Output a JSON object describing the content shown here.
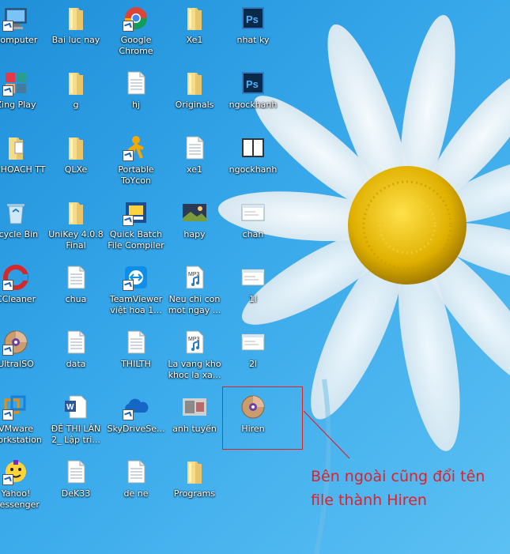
{
  "desktop": {
    "icons": [
      {
        "label": "Computer",
        "kind": "computer"
      },
      {
        "label": "Bai luc nay",
        "kind": "folder"
      },
      {
        "label": "Google Chrome",
        "kind": "chrome"
      },
      {
        "label": "Xe1",
        "kind": "folder"
      },
      {
        "label": "nhat ky",
        "kind": "photoshop"
      },
      {
        "label": "Zing Play",
        "kind": "zing"
      },
      {
        "label": "g",
        "kind": "folder"
      },
      {
        "label": "hj",
        "kind": "document"
      },
      {
        "label": "Originals",
        "kind": "folder"
      },
      {
        "label": "ngockhanh",
        "kind": "photoshop"
      },
      {
        "label": "UY HOACH TT",
        "kind": "folder-doc"
      },
      {
        "label": "QLXe",
        "kind": "folder"
      },
      {
        "label": "Portable ToYcon",
        "kind": "aim"
      },
      {
        "label": "xe1",
        "kind": "document"
      },
      {
        "label": "ngockhanh",
        "kind": "book"
      },
      {
        "label": "ecycle Bin",
        "kind": "recycle"
      },
      {
        "label": "UniKey 4.0.8 Final",
        "kind": "folder"
      },
      {
        "label": "Quick Batch File Compiler",
        "kind": "qbfc"
      },
      {
        "label": "hapy",
        "kind": "image"
      },
      {
        "label": "chan",
        "kind": "window"
      },
      {
        "label": "CCleaner",
        "kind": "ccleaner"
      },
      {
        "label": "chua",
        "kind": "document"
      },
      {
        "label": "TeamViewer việt hoa 1...",
        "kind": "teamviewer"
      },
      {
        "label": "Neu chi con mot ngay ...",
        "kind": "mp3"
      },
      {
        "label": "1l",
        "kind": "window"
      },
      {
        "label": "UltraISO",
        "kind": "disc"
      },
      {
        "label": "data",
        "kind": "document"
      },
      {
        "label": "THILTH",
        "kind": "document"
      },
      {
        "label": "La vang kho khoc la xa...",
        "kind": "mp3"
      },
      {
        "label": "2l",
        "kind": "window"
      },
      {
        "label": "VMware Workstation",
        "kind": "vmware"
      },
      {
        "label": "ĐỀ THI LẦN 2_ Lập tri...",
        "kind": "word"
      },
      {
        "label": "SkyDriveSe...",
        "kind": "skydrive"
      },
      {
        "label": "anh tuyến",
        "kind": "photo"
      },
      {
        "label": "Hiren",
        "kind": "disc"
      },
      {
        "label": "Yahoo! Messenger",
        "kind": "yahoo"
      },
      {
        "label": "DeK33",
        "kind": "document"
      },
      {
        "label": "de ne",
        "kind": "document"
      },
      {
        "label": "Programs",
        "kind": "folder"
      }
    ]
  },
  "annotation": {
    "line1": "Bên ngoài cũng đổi tên",
    "line2": "file thành Hiren"
  },
  "colors": {
    "annotation": "#e0202a",
    "desktop_bg": "#2c9de3"
  }
}
